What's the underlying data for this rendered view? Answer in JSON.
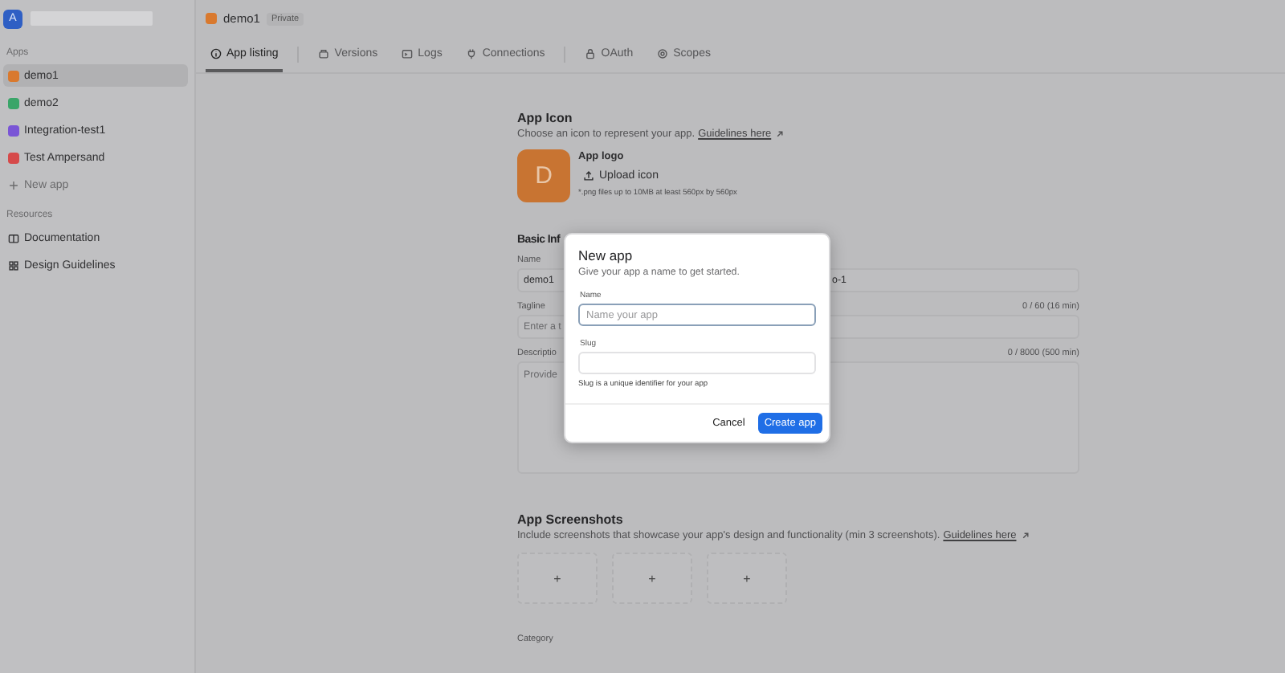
{
  "topbar": {
    "avatar": "A"
  },
  "header": {
    "app_name": "demo1",
    "badge": "Private"
  },
  "sidebar": {
    "apps_title": "Apps",
    "apps": [
      {
        "label": "demo1",
        "color": "#d9792e",
        "selected": true
      },
      {
        "label": "demo2",
        "color": "#3aa569",
        "selected": false
      },
      {
        "label": "Integration-test1",
        "color": "#7a55d6",
        "selected": false
      },
      {
        "label": "Test Ampersand",
        "color": "#d64a4a",
        "selected": false
      }
    ],
    "new_app": "New app",
    "resources_title": "Resources",
    "resources": [
      {
        "label": "Documentation",
        "kind": "book"
      },
      {
        "label": "Design Guidelines",
        "kind": "grid"
      }
    ]
  },
  "tabs": [
    {
      "label": "App listing",
      "kind": "info",
      "selected": true,
      "separator_before": false
    },
    {
      "label": "Versions",
      "kind": "box",
      "selected": false,
      "separator_before": true
    },
    {
      "label": "Logs",
      "kind": "terminal",
      "selected": false,
      "separator_before": false
    },
    {
      "label": "Connections",
      "kind": "plug",
      "selected": false,
      "separator_before": false
    },
    {
      "label": "OAuth",
      "kind": "lock",
      "selected": false,
      "separator_before": true
    },
    {
      "label": "Scopes",
      "kind": "gear",
      "selected": false,
      "separator_before": false
    }
  ],
  "app_icon": {
    "title": "App Icon",
    "description": "Choose an icon to represent your app.",
    "link": "Guidelines here",
    "logo_label": "App logo",
    "logo_letter": "D",
    "upload_button": "Upload icon",
    "hint": "*.png files up to 10MB at least 560px by 560px"
  },
  "basic_info": {
    "title": "Basic Inf",
    "name": {
      "label": "Name",
      "value": "demo1",
      "second_value": "o-1"
    },
    "tagline": {
      "label": "Tagline",
      "placeholder": "Enter a t",
      "counter": "0 / 60 (16 min)"
    },
    "description": {
      "label": "Descriptio",
      "placeholder": "Provide",
      "counter": "0 / 8000 (500 min)"
    }
  },
  "screenshots": {
    "title": "App Screenshots",
    "description": "Include screenshots that showcase your app's design and functionality (min 3 screenshots).",
    "link": "Guidelines here",
    "slots": [
      "+",
      "+",
      "+"
    ]
  },
  "category": {
    "label": "Category"
  },
  "modal": {
    "title": "New app",
    "subtitle": "Give your app a name to get started.",
    "name_label": "Name",
    "name_placeholder": "Name your app",
    "slug_label": "Slug",
    "helper": "Slug is a unique identifier for your app",
    "buttons": [
      {
        "label": "Cancel",
        "kind": "secondary"
      },
      {
        "label": "Create app",
        "kind": "primary"
      }
    ]
  }
}
